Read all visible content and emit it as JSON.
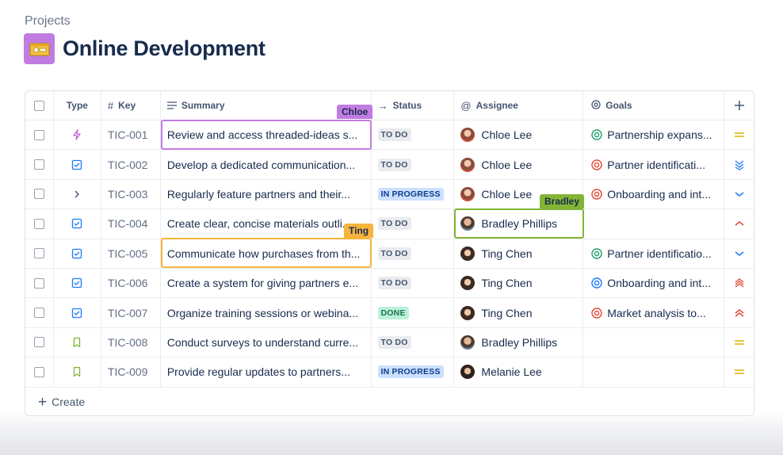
{
  "breadcrumb": "Projects",
  "title": "Online Development",
  "colors": {
    "project_icon": "#c07ce0",
    "chloe_cursor": "#c07ce0",
    "bradley_cursor": "#82b536",
    "ting_cursor": "#f5b43c",
    "priority_medium": "#e2b203",
    "priority_low": "#1d7afc",
    "priority_high": "#e34935"
  },
  "columns": {
    "type": "Type",
    "key": "Key",
    "summary": "Summary",
    "status": "Status",
    "assignee": "Assignee",
    "goals": "Goals"
  },
  "cursors": {
    "chloe": "Chloe",
    "bradley": "Bradley",
    "ting": "Ting"
  },
  "rows": [
    {
      "type": "lightning-icon",
      "key": "TIC-001",
      "summary": "Review and access threaded-ideas s...",
      "status": "TO DO",
      "assignee": "Chloe Lee",
      "goal": "Partnership expans...",
      "goal_color": "#22a06b",
      "priority": "medium"
    },
    {
      "type": "task-icon",
      "key": "TIC-002",
      "summary": "Develop a dedicated communication...",
      "status": "TO DO",
      "assignee": "Chloe Lee",
      "goal": "Partner identificati...",
      "goal_color": "#e34935",
      "priority": "lowest"
    },
    {
      "type": "chevron-right-icon",
      "key": "TIC-003",
      "summary": "Regularly feature partners and their...",
      "status": "IN PROGRESS",
      "assignee": "Chloe Lee",
      "goal": "Onboarding and int...",
      "goal_color": "#e34935",
      "priority": "low"
    },
    {
      "type": "task-icon",
      "key": "TIC-004",
      "summary": "Create clear, concise materials outli...",
      "status": "TO DO",
      "assignee": "Bradley Phillips",
      "goal": "",
      "goal_color": "",
      "priority": "high"
    },
    {
      "type": "task-icon",
      "key": "TIC-005",
      "summary": "Communicate how purchases from th...",
      "status": "TO DO",
      "assignee": "Ting Chen",
      "goal": "Partner identificatio...",
      "goal_color": "#22a06b",
      "priority": "low"
    },
    {
      "type": "task-icon",
      "key": "TIC-006",
      "summary": "Create a system for giving partners e...",
      "status": "TO DO",
      "assignee": "Ting Chen",
      "goal": "Onboarding and int...",
      "goal_color": "#1d7afc",
      "priority": "highest"
    },
    {
      "type": "task-icon",
      "key": "TIC-007",
      "summary": "Organize training sessions or webina...",
      "status": "DONE",
      "assignee": "Ting Chen",
      "goal": "Market analysis to...",
      "goal_color": "#e34935",
      "priority": "higher"
    },
    {
      "type": "story-icon",
      "key": "TIC-008",
      "summary": "Conduct surveys to understand curre...",
      "status": "TO DO",
      "assignee": "Bradley Phillips",
      "goal": "",
      "goal_color": "",
      "priority": "medium"
    },
    {
      "type": "story-icon",
      "key": "TIC-009",
      "summary": "Provide regular updates to partners...",
      "status": "IN PROGRESS",
      "assignee": "Melanie Lee",
      "goal": "",
      "goal_color": "",
      "priority": "medium"
    }
  ],
  "create_label": "Create"
}
